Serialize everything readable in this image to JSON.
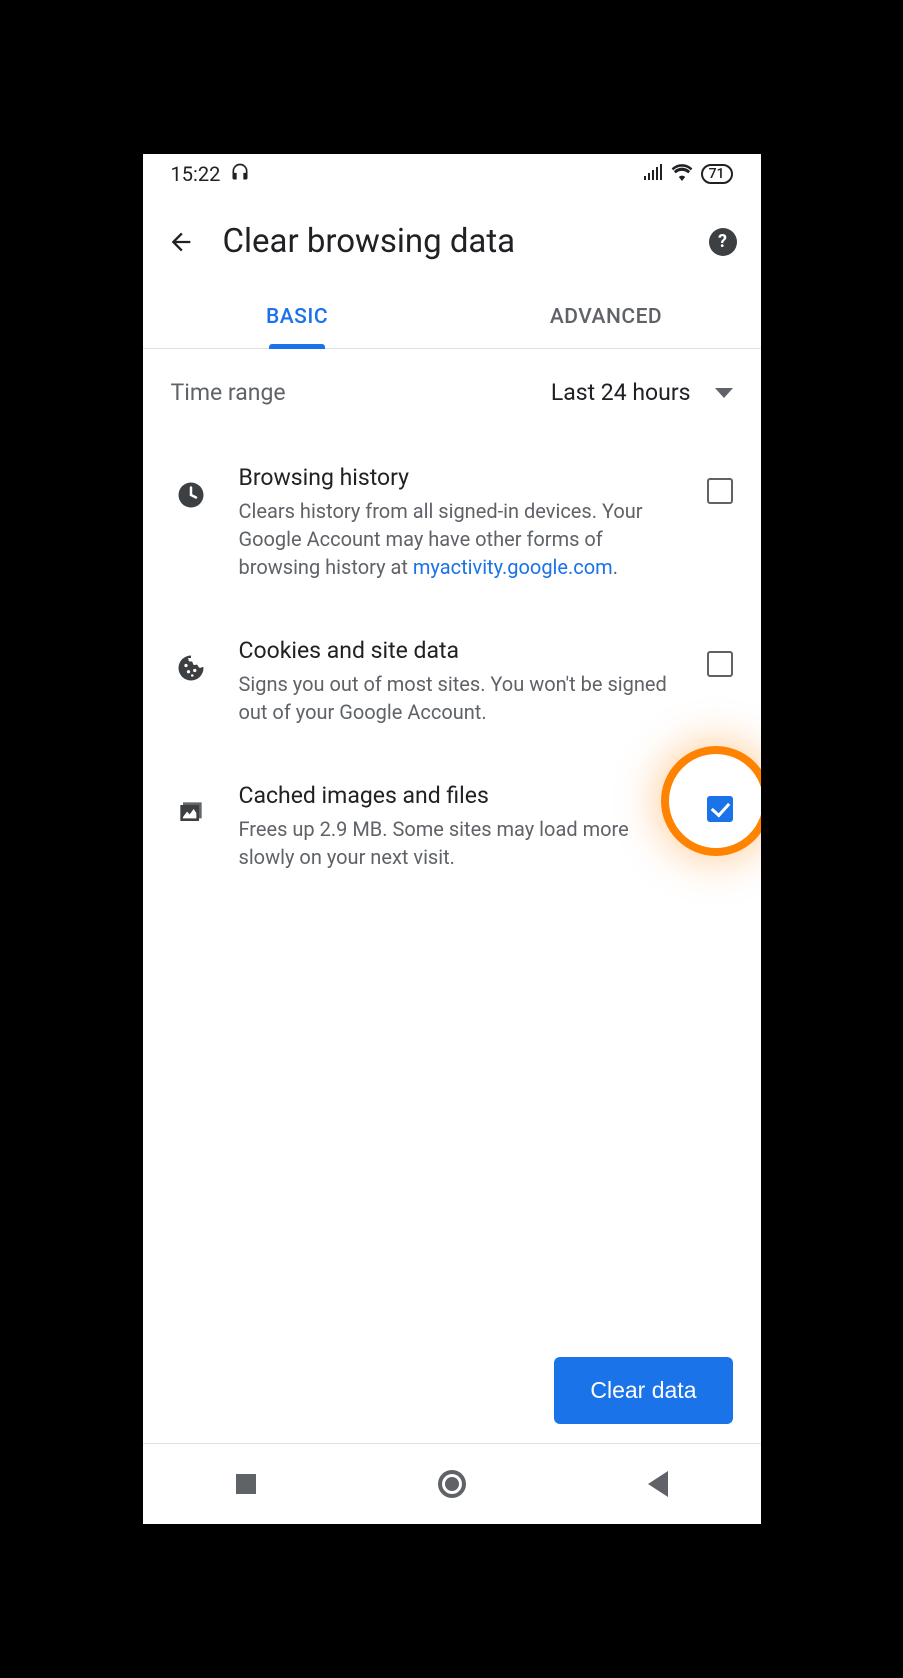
{
  "statusbar": {
    "time": "15:22",
    "battery": "71"
  },
  "header": {
    "title": "Clear browsing data"
  },
  "tabs": {
    "basic": "BASIC",
    "advanced": "ADVANCED"
  },
  "time_range": {
    "label": "Time range",
    "value": "Last 24 hours"
  },
  "items": [
    {
      "title": "Browsing history",
      "desc_pre": "Clears history from all signed-in devices. Your Google Account may have other forms of browsing history at ",
      "link": "myactivity.google.com",
      "desc_post": ".",
      "checked": false
    },
    {
      "title": "Cookies and site data",
      "desc": "Signs you out of most sites. You won't be signed out of your Google Account.",
      "checked": false
    },
    {
      "title": "Cached images and files",
      "desc": "Frees up 2.9 MB. Some sites may load more slowly on your next visit.",
      "checked": true
    }
  ],
  "action": {
    "clear": "Clear data"
  }
}
